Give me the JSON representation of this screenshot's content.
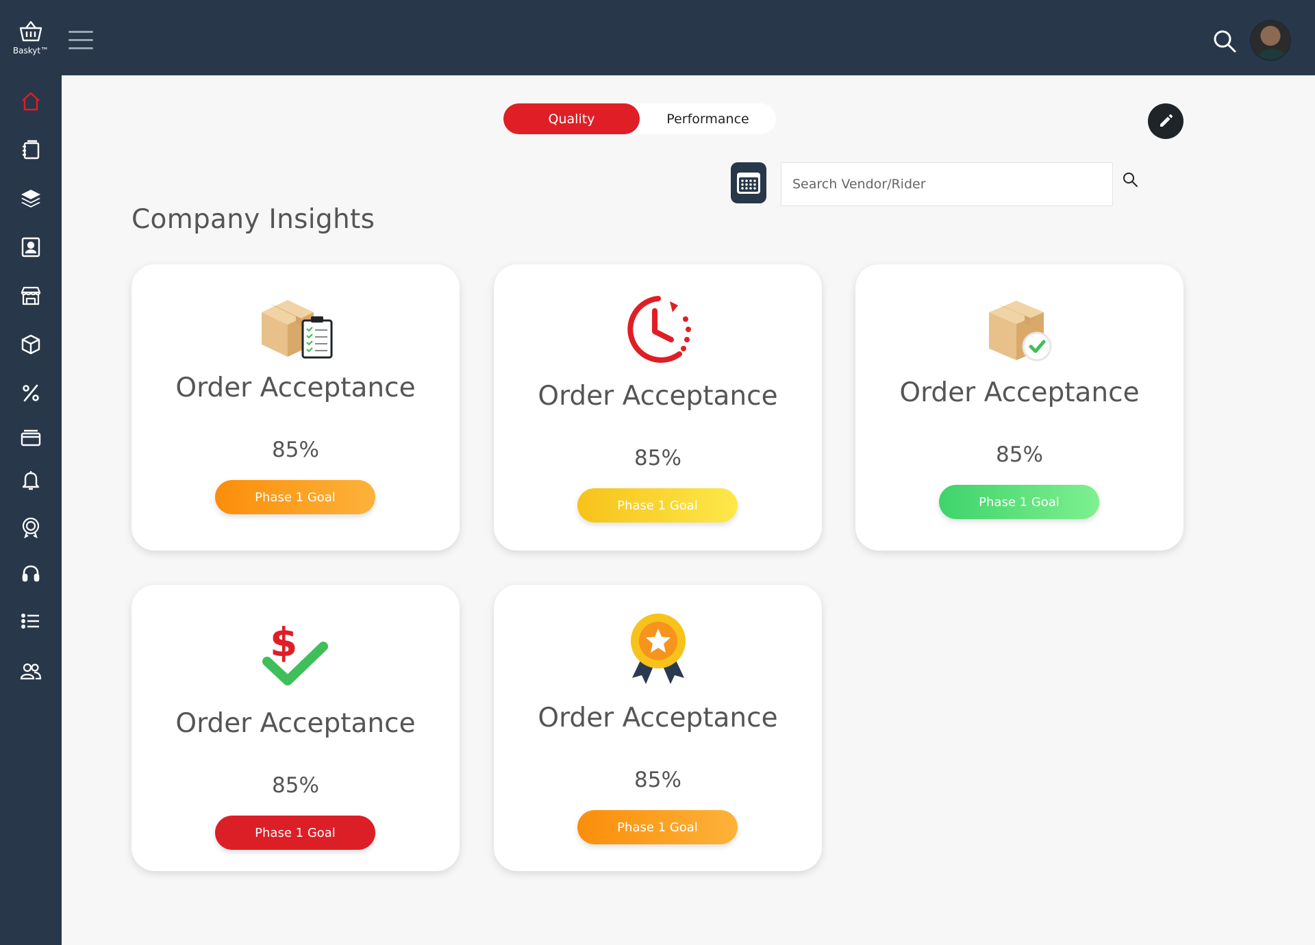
{
  "app": {
    "brand": "Baskyt™",
    "colors": {
      "header": "#28374a",
      "accent": "#e01e26",
      "background": "#f7f7f7"
    }
  },
  "sidebar": {
    "items": [
      {
        "icon": "home-icon",
        "active": true
      },
      {
        "icon": "notebook-icon"
      },
      {
        "icon": "layers-icon"
      },
      {
        "icon": "contact-card-icon"
      },
      {
        "icon": "store-icon"
      },
      {
        "icon": "box-icon"
      },
      {
        "icon": "percent-icon"
      },
      {
        "icon": "card-icon"
      },
      {
        "icon": "bell-icon"
      },
      {
        "icon": "badge-icon"
      },
      {
        "icon": "headset-icon"
      },
      {
        "icon": "list-icon"
      },
      {
        "icon": "users-icon"
      }
    ]
  },
  "tabs": [
    {
      "label": "Quality",
      "active": true
    },
    {
      "label": "Performance",
      "active": false
    }
  ],
  "search": {
    "placeholder": "Search Vendor/Rider",
    "value": ""
  },
  "page": {
    "title": "Company Insights"
  },
  "cards": [
    {
      "icon": "box-clipboard-icon",
      "title": "Order Acceptance",
      "value": "85%",
      "button": "Phase 1 Goal",
      "color": "orange"
    },
    {
      "icon": "clock-icon",
      "title": "Order Acceptance",
      "value": "85%",
      "button": "Phase 1 Goal",
      "color": "yellow"
    },
    {
      "icon": "box-check-icon",
      "title": "Order Acceptance",
      "value": "85%",
      "button": "Phase 1 Goal",
      "color": "green"
    },
    {
      "icon": "dollar-check-icon",
      "title": "Order Acceptance",
      "value": "85%",
      "button": "Phase 1 Goal",
      "color": "red"
    },
    {
      "icon": "award-medal-icon",
      "title": "Order Acceptance",
      "value": "85%",
      "button": "Phase 1 Goal",
      "color": "orange"
    }
  ]
}
